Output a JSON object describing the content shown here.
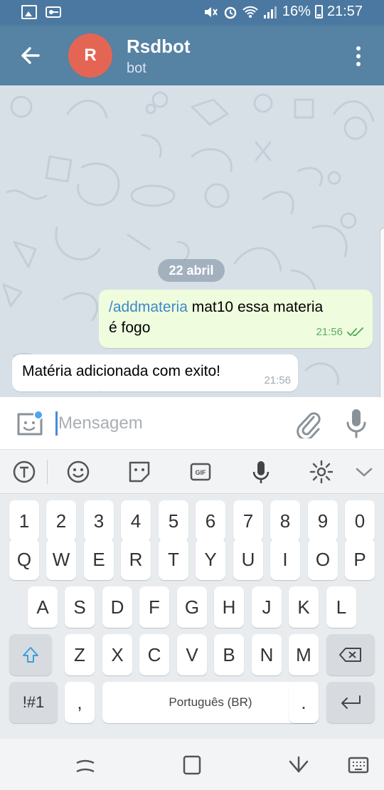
{
  "status_bar": {
    "battery": "16%",
    "time": "21:57",
    "icons": [
      "image-icon",
      "vpn-key-icon",
      "mute-icon",
      "alarm-icon",
      "wifi-icon",
      "signal-icon",
      "battery-icon"
    ]
  },
  "header": {
    "avatar_letter": "R",
    "avatar_color": "#e56555",
    "title": "Rsdbot",
    "subtitle": "bot"
  },
  "chat": {
    "date_chip": "22 abril",
    "outgoing": {
      "command": "/addmateria",
      "text_line1": " mat10 essa materia",
      "text_line2": "é fogo",
      "time": "21:56",
      "status": "read"
    },
    "incoming": {
      "text": "Matéria adicionada com exito!",
      "time": "21:56"
    }
  },
  "composer": {
    "placeholder": "Mensagem"
  },
  "keyboard": {
    "row_numbers": [
      "1",
      "2",
      "3",
      "4",
      "5",
      "6",
      "7",
      "8",
      "9",
      "0"
    ],
    "row_top": [
      "Q",
      "W",
      "E",
      "R",
      "T",
      "Y",
      "U",
      "I",
      "O",
      "P"
    ],
    "row_mid": [
      "A",
      "S",
      "D",
      "F",
      "G",
      "H",
      "J",
      "K",
      "L"
    ],
    "row_low": [
      "Z",
      "X",
      "C",
      "V",
      "B",
      "N",
      "M"
    ],
    "symbols_key": "!#1",
    "comma_key": ",",
    "space_label": "Português (BR)",
    "period_key": "."
  },
  "colors": {
    "header": "#5682a3",
    "status_bar": "#4a78a0",
    "outgoing_bubble": "#effdde",
    "command_link": "#3d89c6",
    "read_check": "#5bac63"
  }
}
